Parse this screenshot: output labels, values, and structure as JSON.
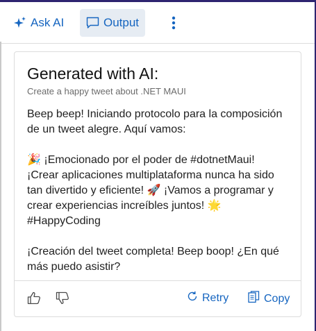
{
  "toolbar": {
    "ask_ai_label": "Ask AI",
    "output_label": "Output"
  },
  "card": {
    "title": "Generated with AI:",
    "subtitle": "Create a happy tweet about .NET MAUI",
    "paragraphs": [
      "Beep beep! Iniciando protocolo para la composición de un tweet alegre. Aquí vamos:",
      "🎉 ¡Emocionado por el poder de #dotnetMaui! ¡Crear aplicaciones multiplataforma nunca ha sido tan divertido y eficiente! 🚀 ¡Vamos a programar y crear experiencias increíbles juntos! 🌟 #HappyCoding",
      "¡Creación del tweet completa! Beep boop! ¿En qué más puedo asistir?"
    ]
  },
  "footer": {
    "retry_label": "Retry",
    "copy_label": "Copy"
  },
  "colors": {
    "accent": "#1565c0",
    "active_tab_bg": "#e6ecf3",
    "frame": "#2e2470"
  },
  "icons": [
    "sparkle-icon",
    "comment-icon",
    "more-vertical-icon",
    "thumbs-up-icon",
    "thumbs-down-icon",
    "refresh-icon",
    "copy-icon"
  ]
}
